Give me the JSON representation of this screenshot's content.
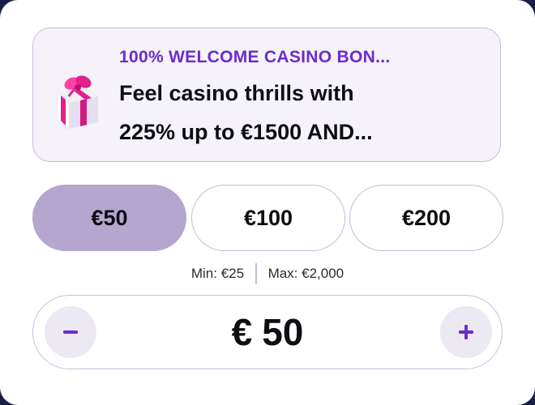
{
  "bonus": {
    "title": "100% WELCOME CASINO BON...",
    "line1": "Feel casino thrills with",
    "line2": "225% up to €1500 AND..."
  },
  "amounts": [
    {
      "label": "€50",
      "selected": true
    },
    {
      "label": "€100",
      "selected": false
    },
    {
      "label": "€200",
      "selected": false
    }
  ],
  "limits": {
    "min": "Min: €25",
    "max": "Max: €2,000"
  },
  "stepper": {
    "currency": "€",
    "value": "50"
  },
  "colors": {
    "accent": "#6a2cd0",
    "selected_bg": "#b4a6cf",
    "border": "#c6bcd9",
    "gift_pink": "#e0218a"
  },
  "icons": {
    "gift": "gift-icon",
    "minus": "minus-icon",
    "plus": "plus-icon"
  }
}
